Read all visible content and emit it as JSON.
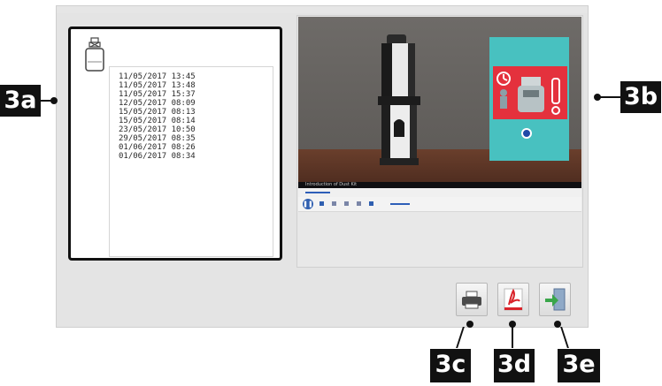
{
  "history": {
    "items": [
      "11/05/2017 13:45",
      "11/05/2017 13:48",
      "11/05/2017 15:37",
      "12/05/2017 08:09",
      "15/05/2017 08:13",
      "15/05/2017 08:14",
      "23/05/2017 10:50",
      "29/05/2017 08:35",
      "01/06/2017 08:26",
      "01/06/2017 08:34"
    ]
  },
  "video": {
    "title": "Introduction of Dust Kit"
  },
  "callouts": {
    "a": "3a",
    "b": "3b",
    "c": "3c",
    "d": "3d",
    "e": "3e"
  },
  "colors": {
    "teal": "#48c1c0",
    "alert_red": "#e4313d",
    "pdf_red": "#d9242b",
    "exit_green": "#3aa64a",
    "play_blue": "#2f5fb0"
  },
  "icons": {
    "device": "jar-icon",
    "print": "printer-icon",
    "pdf": "pdf-icon",
    "exit": "exit-icon"
  }
}
